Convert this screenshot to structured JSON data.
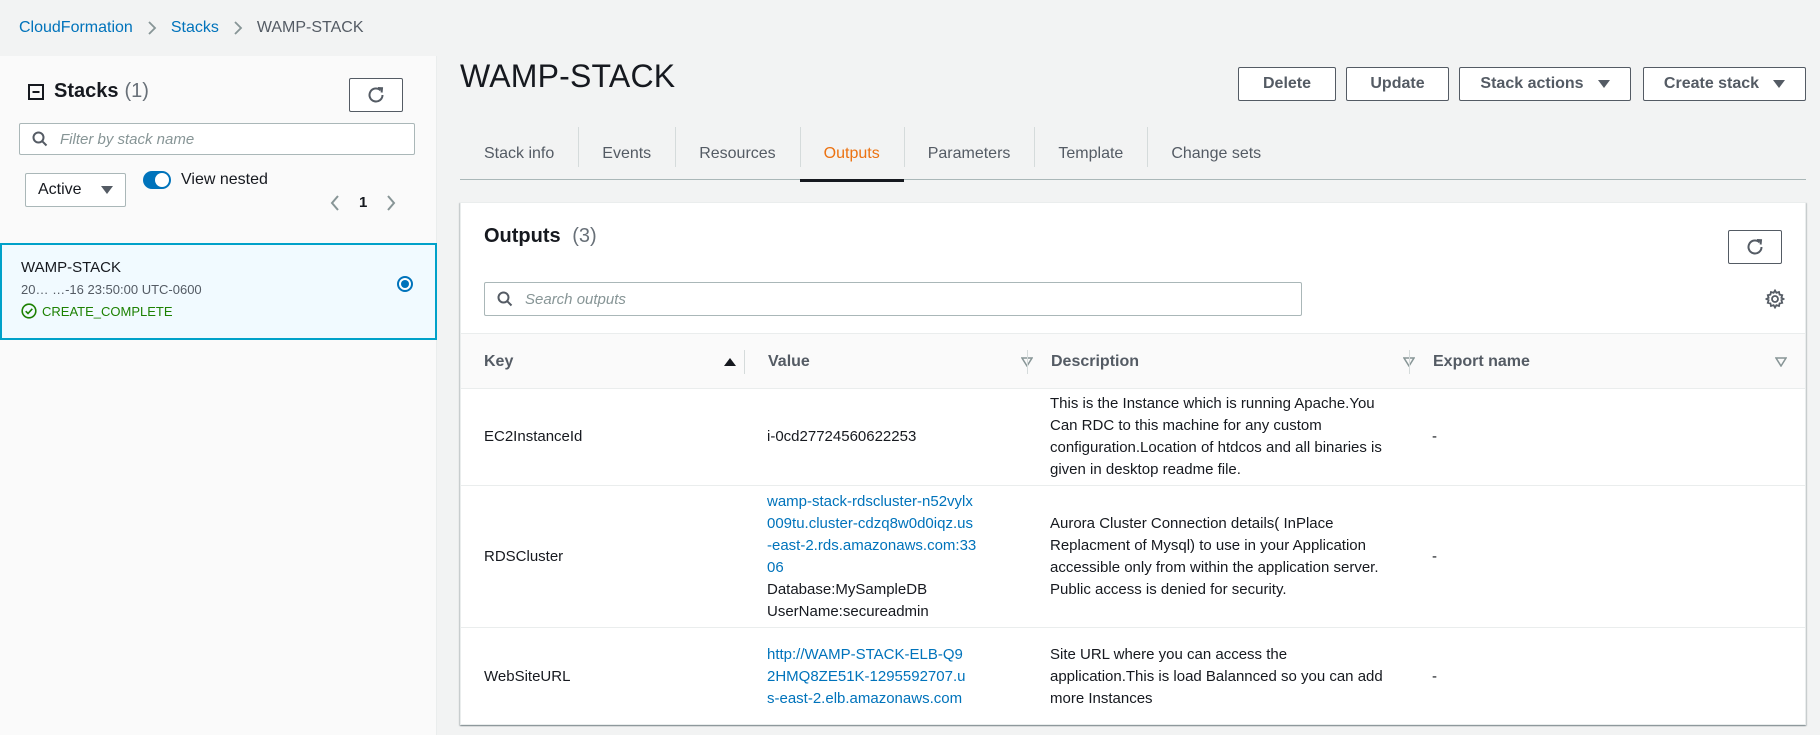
{
  "breadcrumb": {
    "items": [
      "CloudFormation",
      "Stacks"
    ],
    "current": "WAMP-STACK"
  },
  "sidebar": {
    "title": "Stacks",
    "count": "(1)",
    "filter_placeholder": "Filter by stack name",
    "status_filter": "Active",
    "view_nested_label": "View nested",
    "view_nested_on": true,
    "page": "1",
    "stack": {
      "name": "WAMP-STACK",
      "time": "20… …-16 23:50:00 UTC-0600",
      "status": "CREATE_COMPLETE"
    }
  },
  "main": {
    "title": "WAMP-STACK",
    "actions": {
      "delete": "Delete",
      "update": "Update",
      "stack_actions": "Stack actions",
      "create_stack": "Create stack"
    },
    "tabs": [
      {
        "label": "Stack info"
      },
      {
        "label": "Events"
      },
      {
        "label": "Resources"
      },
      {
        "label": "Outputs"
      },
      {
        "label": "Parameters"
      },
      {
        "label": "Template"
      },
      {
        "label": "Change sets"
      }
    ],
    "active_tab": "Outputs"
  },
  "outputs": {
    "title": "Outputs",
    "count": "(3)",
    "search_placeholder": "Search outputs",
    "columns": {
      "key": "Key",
      "value": "Value",
      "description": "Description",
      "export_name": "Export name"
    },
    "rows": [
      {
        "key": "EC2InstanceId",
        "value": "i-0cd27724560622253",
        "description": "This is the Instance which is running Apache.You Can RDC to this machine for any custom configuration.Location of htdcos and all binaries is given in desktop readme file.",
        "export_name": "-"
      },
      {
        "key": "RDSCluster",
        "value_link": "wamp-stack-rdscluster-n52vylx009tu.cluster-cdzq8w0d0iqz.us-east-2.rds.amazonaws.com:3306",
        "value_line2": "Database:MySampleDB",
        "value_line3": "UserName:secureadmin",
        "description": "Aurora Cluster Connection details( InPlace Replacment of Mysql) to use in your Application accessible only from within the application server. Public access is denied for security.",
        "export_name": "-"
      },
      {
        "key": "WebSiteURL",
        "value_link": "http://WAMP-STACK-ELB-Q92HMQ8ZE51K-1295592707.us-east-2.elb.amazonaws.com",
        "description": "Site URL where you can access the application.This is load Balannced so you can add more Instances",
        "export_name": "-"
      }
    ]
  },
  "colors": {
    "link": "#0073bb",
    "active_tab": "#ec7211",
    "success": "#1d8102",
    "selected_border": "#00a1c9"
  }
}
